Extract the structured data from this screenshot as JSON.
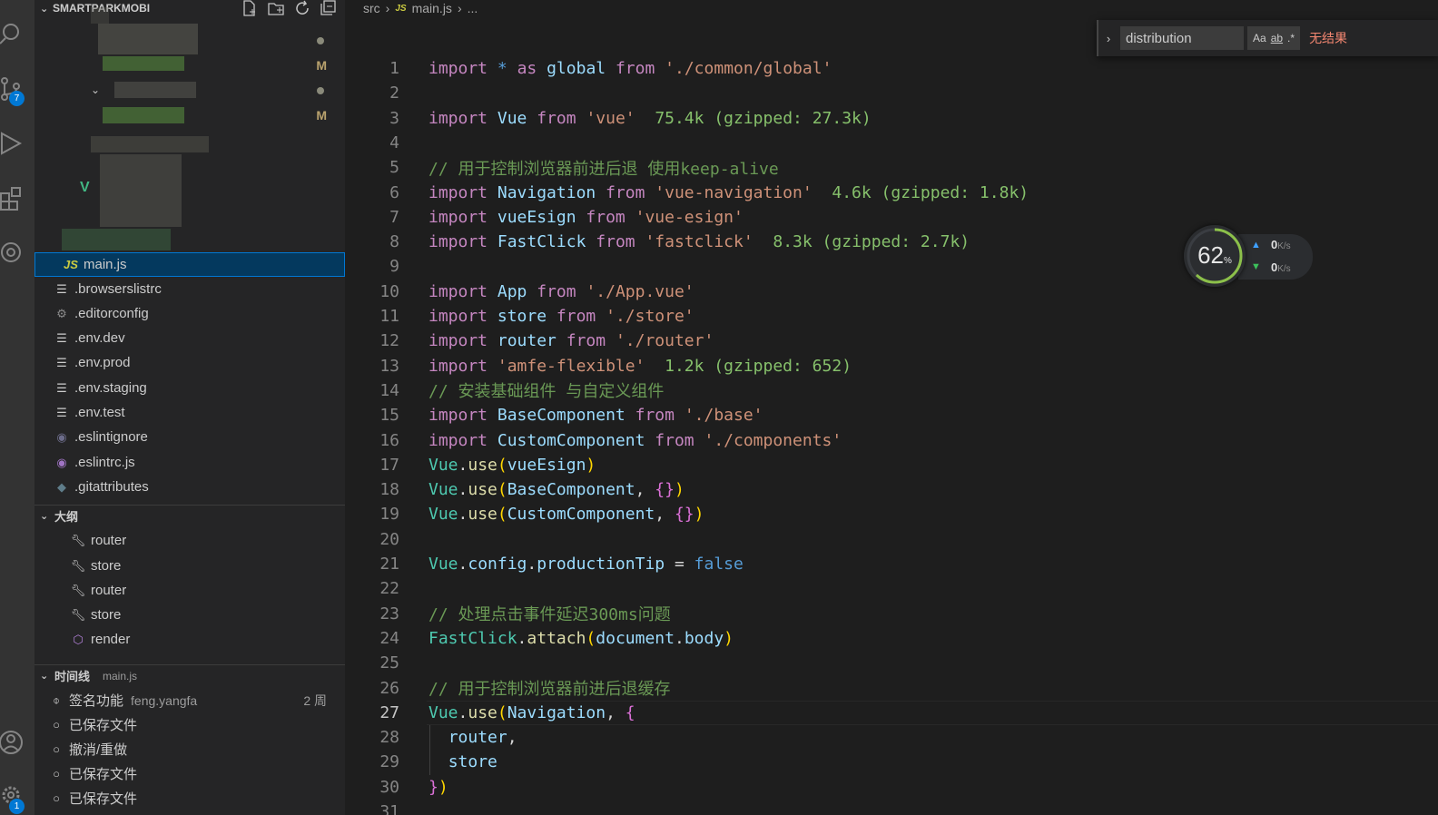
{
  "activity_bar": {
    "items": [
      {
        "icon": "search-icon"
      },
      {
        "icon": "source-control-icon",
        "badge": "7"
      },
      {
        "icon": "run-debug-icon"
      },
      {
        "icon": "extensions-icon"
      },
      {
        "icon": "openai-icon"
      },
      {
        "icon": "account-icon"
      },
      {
        "icon": "settings-gear-icon",
        "badge": "1"
      }
    ]
  },
  "explorer": {
    "title": "SMARTPARKMOBI",
    "actions": [
      "new-file-icon",
      "new-folder-icon",
      "refresh-icon",
      "collapse-all-icon"
    ],
    "git_marks": [
      "M",
      "M"
    ],
    "files": [
      {
        "name": "main.js",
        "icon": "JS",
        "selected": true
      },
      {
        "name": ".browserslistrc",
        "icon": "lines-icon"
      },
      {
        "name": ".editorconfig",
        "icon": "gear-file-icon"
      },
      {
        "name": ".env.dev",
        "icon": "lines-icon"
      },
      {
        "name": ".env.prod",
        "icon": "lines-icon"
      },
      {
        "name": ".env.staging",
        "icon": "lines-icon"
      },
      {
        "name": ".env.test",
        "icon": "lines-icon"
      },
      {
        "name": ".eslintignore",
        "icon": "eslint-icon"
      },
      {
        "name": ".eslintrc.js",
        "icon": "eslint-icon"
      },
      {
        "name": ".gitattributes",
        "icon": "git-icon"
      }
    ]
  },
  "outline": {
    "title": "大纲",
    "items": [
      {
        "label": "router",
        "icon": "wrench-icon"
      },
      {
        "label": "store",
        "icon": "wrench-icon"
      },
      {
        "label": "router",
        "icon": "wrench-icon"
      },
      {
        "label": "store",
        "icon": "wrench-icon"
      },
      {
        "label": "render",
        "icon": "cube-icon"
      }
    ]
  },
  "timeline": {
    "title": "时间线",
    "file": "main.js",
    "items": [
      {
        "label": "签名功能",
        "author": "feng.yangfa",
        "time": "2 周",
        "icon": "commit-icon"
      },
      {
        "label": "已保存文件",
        "author": "",
        "time": "",
        "icon": "circle-icon"
      },
      {
        "label": "撤消/重做",
        "author": "",
        "time": "",
        "icon": "circle-icon"
      },
      {
        "label": "已保存文件",
        "author": "",
        "time": "",
        "icon": "circle-icon"
      },
      {
        "label": "已保存文件",
        "author": "",
        "time": "",
        "icon": "circle-icon"
      }
    ]
  },
  "breadcrumb": [
    "src",
    "main.js",
    "..."
  ],
  "find_widget": {
    "query": "distribution",
    "options": [
      "Aa",
      "ab",
      ".*"
    ],
    "result": "无结果"
  },
  "net_monitor": {
    "cpu_percent": "62",
    "upload": "0",
    "download": "0",
    "unit": "K/s"
  },
  "editor": {
    "current_line": 27,
    "lines": [
      [
        [
          "kw",
          "import"
        ],
        [
          "pl",
          " "
        ],
        [
          "bl",
          "*"
        ],
        [
          "pl",
          " "
        ],
        [
          "kw",
          "as"
        ],
        [
          "pl",
          " "
        ],
        [
          "id",
          "global"
        ],
        [
          "pl",
          " "
        ],
        [
          "kw",
          "from"
        ],
        [
          "pl",
          " "
        ],
        [
          "str",
          "'./common/global'"
        ]
      ],
      [],
      [
        [
          "kw",
          "import"
        ],
        [
          "pl",
          " "
        ],
        [
          "id",
          "Vue"
        ],
        [
          "pl",
          " "
        ],
        [
          "kw",
          "from"
        ],
        [
          "pl",
          " "
        ],
        [
          "str",
          "'vue'"
        ],
        [
          "pl",
          "  "
        ],
        [
          "size",
          "75.4k (gzipped: 27.3k)"
        ]
      ],
      [],
      [
        [
          "cm",
          "// 用于控制浏览器前进后退 使用keep-alive"
        ]
      ],
      [
        [
          "kw",
          "import"
        ],
        [
          "pl",
          " "
        ],
        [
          "id",
          "Navigation"
        ],
        [
          "pl",
          " "
        ],
        [
          "kw",
          "from"
        ],
        [
          "pl",
          " "
        ],
        [
          "str",
          "'vue-navigation'"
        ],
        [
          "pl",
          "  "
        ],
        [
          "size",
          "4.6k (gzipped: 1.8k)"
        ]
      ],
      [
        [
          "kw",
          "import"
        ],
        [
          "pl",
          " "
        ],
        [
          "id",
          "vueEsign"
        ],
        [
          "pl",
          " "
        ],
        [
          "kw",
          "from"
        ],
        [
          "pl",
          " "
        ],
        [
          "str",
          "'vue-esign'"
        ]
      ],
      [
        [
          "kw",
          "import"
        ],
        [
          "pl",
          " "
        ],
        [
          "id",
          "FastClick"
        ],
        [
          "pl",
          " "
        ],
        [
          "kw",
          "from"
        ],
        [
          "pl",
          " "
        ],
        [
          "str",
          "'fastclick'"
        ],
        [
          "pl",
          "  "
        ],
        [
          "size",
          "8.3k (gzipped: 2.7k)"
        ]
      ],
      [],
      [
        [
          "kw",
          "import"
        ],
        [
          "pl",
          " "
        ],
        [
          "id",
          "App"
        ],
        [
          "pl",
          " "
        ],
        [
          "kw",
          "from"
        ],
        [
          "pl",
          " "
        ],
        [
          "str",
          "'./App.vue'"
        ]
      ],
      [
        [
          "kw",
          "import"
        ],
        [
          "pl",
          " "
        ],
        [
          "id",
          "store"
        ],
        [
          "pl",
          " "
        ],
        [
          "kw",
          "from"
        ],
        [
          "pl",
          " "
        ],
        [
          "str",
          "'./store'"
        ]
      ],
      [
        [
          "kw",
          "import"
        ],
        [
          "pl",
          " "
        ],
        [
          "id",
          "router"
        ],
        [
          "pl",
          " "
        ],
        [
          "kw",
          "from"
        ],
        [
          "pl",
          " "
        ],
        [
          "str",
          "'./router'"
        ]
      ],
      [
        [
          "kw",
          "import"
        ],
        [
          "pl",
          " "
        ],
        [
          "str",
          "'amfe-flexible'"
        ],
        [
          "pl",
          "  "
        ],
        [
          "size",
          "1.2k (gzipped: 652)"
        ]
      ],
      [
        [
          "cm",
          "// 安装基础组件 与自定义组件"
        ]
      ],
      [
        [
          "kw",
          "import"
        ],
        [
          "pl",
          " "
        ],
        [
          "id",
          "BaseComponent"
        ],
        [
          "pl",
          " "
        ],
        [
          "kw",
          "from"
        ],
        [
          "pl",
          " "
        ],
        [
          "str",
          "'./base'"
        ]
      ],
      [
        [
          "kw",
          "import"
        ],
        [
          "pl",
          " "
        ],
        [
          "id",
          "CustomComponent"
        ],
        [
          "pl",
          " "
        ],
        [
          "kw",
          "from"
        ],
        [
          "pl",
          " "
        ],
        [
          "str",
          "'./components'"
        ]
      ],
      [
        [
          "cls",
          "Vue"
        ],
        [
          "pl",
          "."
        ],
        [
          "fn",
          "use"
        ],
        [
          "p1",
          "("
        ],
        [
          "id",
          "vueEsign"
        ],
        [
          "p1",
          ")"
        ]
      ],
      [
        [
          "cls",
          "Vue"
        ],
        [
          "pl",
          "."
        ],
        [
          "fn",
          "use"
        ],
        [
          "p1",
          "("
        ],
        [
          "id",
          "BaseComponent"
        ],
        [
          "pl",
          ", "
        ],
        [
          "p2",
          "{}"
        ],
        [
          "p1",
          ")"
        ]
      ],
      [
        [
          "cls",
          "Vue"
        ],
        [
          "pl",
          "."
        ],
        [
          "fn",
          "use"
        ],
        [
          "p1",
          "("
        ],
        [
          "id",
          "CustomComponent"
        ],
        [
          "pl",
          ", "
        ],
        [
          "p2",
          "{}"
        ],
        [
          "p1",
          ")"
        ]
      ],
      [],
      [
        [
          "cls",
          "Vue"
        ],
        [
          "pl",
          "."
        ],
        [
          "id",
          "config"
        ],
        [
          "pl",
          "."
        ],
        [
          "id",
          "productionTip"
        ],
        [
          "pl",
          " = "
        ],
        [
          "bl",
          "false"
        ]
      ],
      [],
      [
        [
          "cm",
          "// 处理点击事件延迟300ms问题"
        ]
      ],
      [
        [
          "cls",
          "FastClick"
        ],
        [
          "pl",
          "."
        ],
        [
          "fn",
          "attach"
        ],
        [
          "p1",
          "("
        ],
        [
          "id",
          "document"
        ],
        [
          "pl",
          "."
        ],
        [
          "id",
          "body"
        ],
        [
          "p1",
          ")"
        ]
      ],
      [],
      [
        [
          "cm",
          "// 用于控制浏览器前进后退缓存"
        ]
      ],
      [
        [
          "cls",
          "Vue"
        ],
        [
          "pl",
          "."
        ],
        [
          "fn",
          "use"
        ],
        [
          "p1",
          "("
        ],
        [
          "id",
          "Navigation"
        ],
        [
          "pl",
          ", "
        ],
        [
          "p2",
          "{"
        ]
      ],
      [
        [
          "pl",
          "  "
        ],
        [
          "id",
          "router"
        ],
        [
          "pl",
          ","
        ]
      ],
      [
        [
          "pl",
          "  "
        ],
        [
          "id",
          "store"
        ]
      ],
      [
        [
          "p2",
          "}"
        ],
        [
          "p1",
          ")"
        ]
      ],
      []
    ]
  },
  "colors": {
    "accent": "#0078d4",
    "selection": "#04395e",
    "no_result": "#f48771"
  }
}
